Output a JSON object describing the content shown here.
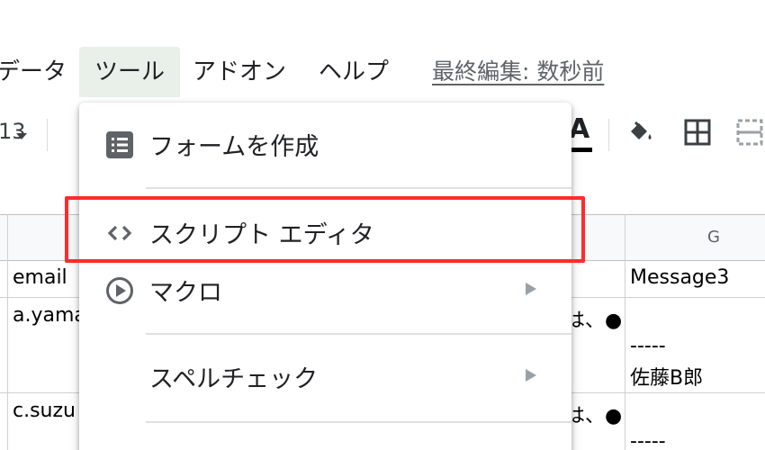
{
  "menubar": {
    "data": "データ",
    "tools": "ツール",
    "addons": "アドオン",
    "help": "ヘルプ",
    "last_edit": "最終編集: 数秒前"
  },
  "toolbar": {
    "font_size": "13",
    "text_color_glyph": "A",
    "text_color_value": "#000000"
  },
  "grid": {
    "column_g": "G",
    "rows": [
      {
        "email": "email",
        "message": "",
        "g": "Message3"
      },
      {
        "email": "a.yama",
        "message": "は、●",
        "g": "-----",
        "g2": "佐藤B郎"
      },
      {
        "email": "c.suzu",
        "message": "は、●",
        "g": "-----"
      }
    ]
  },
  "tools_menu": {
    "items": [
      {
        "label": "フォームを作成",
        "icon": "form-list-icon"
      },
      {
        "label": "スクリプト エディタ",
        "icon": "code-brackets-icon"
      },
      {
        "label": "マクロ",
        "icon": "play-circle-icon",
        "submenu": true
      },
      {
        "label": "スペルチェック",
        "icon": "",
        "submenu": true
      }
    ]
  },
  "colors": {
    "active_menu_bg": "#e8f0e9",
    "highlight": "#ff2b2b"
  }
}
